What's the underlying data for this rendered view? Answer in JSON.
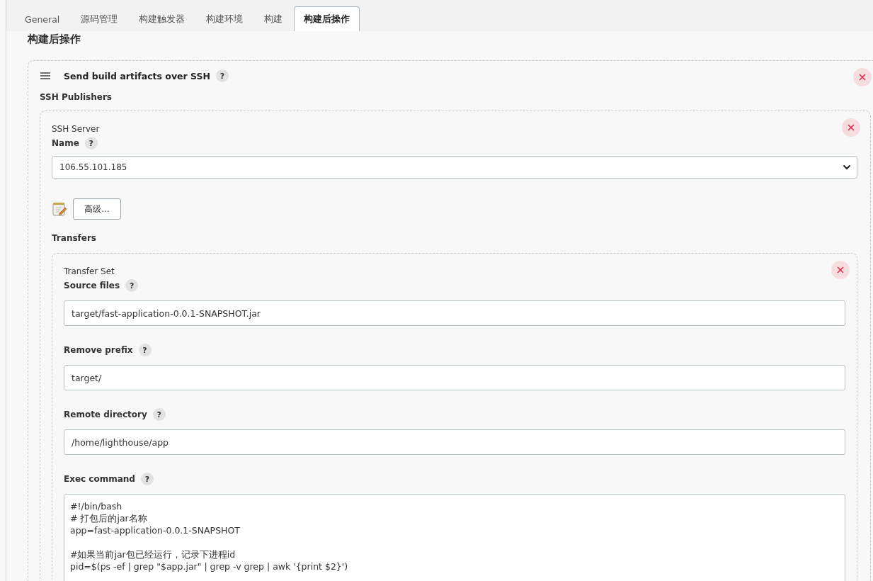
{
  "tabs": [
    {
      "label": "General",
      "selected": false
    },
    {
      "label": "源码管理",
      "selected": false
    },
    {
      "label": "构建触发器",
      "selected": false
    },
    {
      "label": "构建环境",
      "selected": false
    },
    {
      "label": "构建",
      "selected": false
    },
    {
      "label": "构建后操作",
      "selected": true
    }
  ],
  "section_title": "构建后操作",
  "step": {
    "title": "Send build artifacts over SSH",
    "help": "?",
    "publishers_label": "SSH Publishers",
    "server": {
      "heading": "SSH Server",
      "name_label": "Name",
      "help": "?",
      "name_value": "106.55.101.185",
      "advanced_button": "高级...",
      "transfers_label": "Transfers",
      "transfer_set": {
        "heading": "Transfer Set",
        "fields": [
          {
            "label": "Source files",
            "help": "?",
            "value": "target/fast-application-0.0.1-SNAPSHOT.jar"
          },
          {
            "label": "Remove prefix",
            "help": "?",
            "value": "target/"
          },
          {
            "label": "Remote directory",
            "help": "?",
            "value": "/home/lighthouse/app"
          }
        ],
        "exec": {
          "label": "Exec command",
          "help": "?",
          "value": "#!/bin/bash\n# 打包后的jar名称\napp=fast-application-0.0.1-SNAPSHOT\n\n#如果当前jar包已经运行，记录下进程id\npid=$(ps -ef | grep \"$app.jar\" | grep -v grep | awk '{print $2}')"
        }
      }
    }
  }
}
